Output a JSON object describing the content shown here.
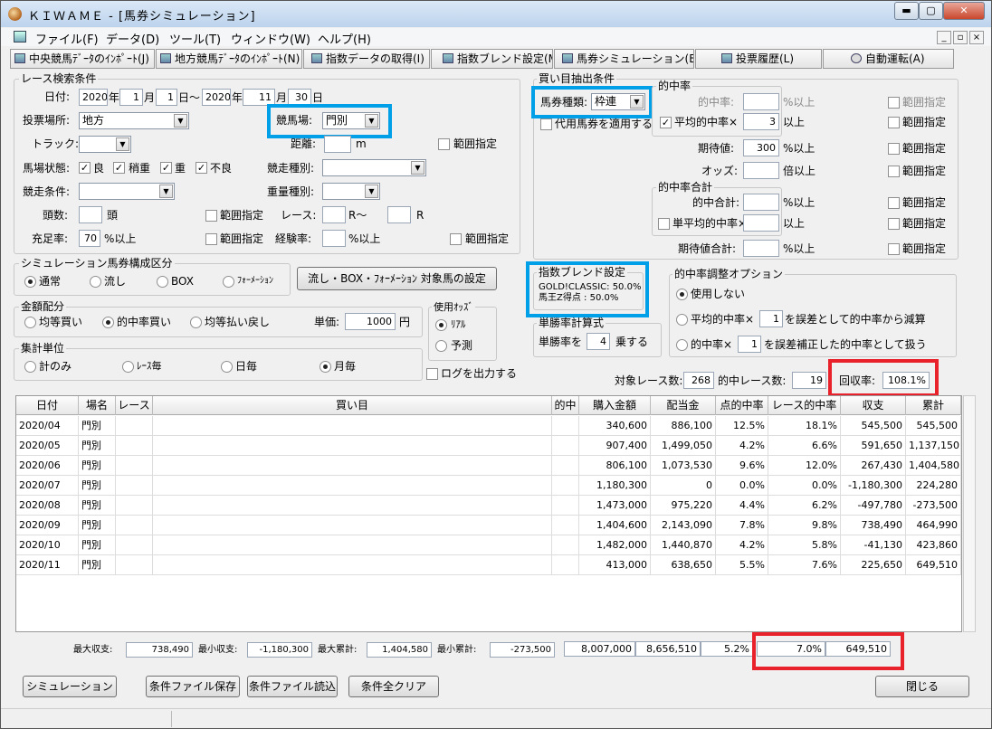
{
  "window": {
    "title": "ＫＩＷＡＭＥ - [馬券シミュレーション]",
    "minimize": "▬",
    "maximize": "▢",
    "close": "✕"
  },
  "menu": [
    "ファイル(F)",
    "データ(D)",
    "ツール(T)",
    "ウィンドウ(W)",
    "ヘルプ(H)"
  ],
  "mdi": [
    "_",
    "▫",
    "×"
  ],
  "toolbar": [
    "中央競馬ﾃﾞｰﾀのｲﾝﾎﾟｰﾄ(J)",
    "地方競馬ﾃﾞｰﾀのｲﾝﾎﾟｰﾄ(N)",
    "指数データの取得(I)",
    "指数ブレンド設定(M)",
    "馬券シミュレーション(B)",
    "投票履歴(L)",
    "自動運転(A)"
  ],
  "race": {
    "title": "レース検索条件",
    "date_label": "日付:",
    "y1": "2020",
    "m1": "1",
    "d1": "1",
    "y2": "2020",
    "m2": "11",
    "d2": "30",
    "nen": "年",
    "tsuki": "月",
    "hi": "日",
    "kara": "日～",
    "venue_label": "投票場所:",
    "venue": "地方",
    "keiba_label": "競馬場:",
    "keiba": "門別",
    "track_label": "トラック:",
    "distance_label": "距離:",
    "distance_unit": "m",
    "range": "範囲指定",
    "baba_label": "馬場状態:",
    "baba": [
      "良",
      "稍重",
      "重",
      "不良"
    ],
    "kyoso_label": "競走種別:",
    "joken_label": "競走条件:",
    "juryo_label": "重量種別:",
    "tosu_label": "頭数:",
    "tosu_unit": "頭",
    "race_label": "レース:",
    "race_from": "R～",
    "race_to": "R",
    "juso_label": "充足率:",
    "juso_val": "70",
    "ijo": "%以上",
    "keiken_label": "経験率:",
    "keiken_unit": "%以上"
  },
  "sim": {
    "title": "シミュレーション馬券構成区分",
    "opts": [
      "通常",
      "流し",
      "BOX",
      "ﾌｫｰﾒｰｼｮﾝ"
    ],
    "setting_btn": "流し・BOX・ﾌｫｰﾒｰｼｮﾝ 対象馬の設定"
  },
  "kingaku": {
    "title": "金額配分",
    "opts": [
      "均等買い",
      "的中率買い",
      "均等払い戻し"
    ],
    "tanka_label": "単価:",
    "tanka": "1000",
    "yen": "円"
  },
  "odds": {
    "title": "使用ｵｯｽﾞ",
    "opts": [
      "ﾘｱﾙ",
      "予測"
    ]
  },
  "shukei": {
    "title": "集計単位",
    "opts": [
      "計のみ",
      "ﾚｰｽ毎",
      "日毎",
      "月毎"
    ]
  },
  "log": "ログを出力する",
  "kaime": {
    "title": "買い目抽出条件",
    "shurui_label": "馬券種類:",
    "shurui": "枠連",
    "daiyo": "代用馬券を適用する"
  },
  "tekichu": {
    "title": "的中率",
    "rate_label": "的中率:",
    "avg_label": "平均的中率×",
    "avg_val": "3",
    "ijo": "%以上",
    "ijo2": "以上",
    "kitai_label": "期待値:",
    "kitai_val": "300",
    "odds_label": "オッズ:",
    "odds_unit": "倍以上",
    "range": "範囲指定"
  },
  "gokei": {
    "title": "的中率合計",
    "total_label": "的中合計:",
    "tan_label": "単平均的中率×",
    "kitai_label": "期待値合計:",
    "pct": "%以上",
    "ijo": "以上"
  },
  "blend": {
    "title": "指数ブレンド設定",
    "l1": "GOLD!CLASSIC: 50.0%",
    "l2": "馬王Z得点 : 50.0%"
  },
  "chosei": {
    "title": "的中率調整オプション",
    "o1": "使用しない",
    "o2a": "平均的中率×",
    "o2v": "1",
    "o2b": "を誤差として的中率から減算",
    "o3a": "的中率×",
    "o3v": "1",
    "o3b": "を誤差補正した的中率として扱う"
  },
  "tansho": {
    "title": "単勝率計算式",
    "a": "単勝率を",
    "v": "4",
    "b": "乗する"
  },
  "summary": {
    "target_label": "対象レース数:",
    "target": "268",
    "hit_label": "的中レース数:",
    "hit": "19",
    "recov_label": "回収率:",
    "recov": "108.1%"
  },
  "table": {
    "headers": [
      "日付",
      "場名",
      "レース",
      "買い目",
      "的中",
      "購入金額",
      "配当金",
      "点的中率",
      "レース的中率",
      "収支",
      "累計"
    ],
    "rows": [
      [
        "2020/04",
        "門別",
        "",
        "",
        "",
        "340,600",
        "886,100",
        "12.5%",
        "18.1%",
        "545,500",
        "545,500"
      ],
      [
        "2020/05",
        "門別",
        "",
        "",
        "",
        "907,400",
        "1,499,050",
        "4.2%",
        "6.6%",
        "591,650",
        "1,137,150"
      ],
      [
        "2020/06",
        "門別",
        "",
        "",
        "",
        "806,100",
        "1,073,530",
        "9.6%",
        "12.0%",
        "267,430",
        "1,404,580"
      ],
      [
        "2020/07",
        "門別",
        "",
        "",
        "",
        "1,180,300",
        "0",
        "0.0%",
        "0.0%",
        "-1,180,300",
        "224,280"
      ],
      [
        "2020/08",
        "門別",
        "",
        "",
        "",
        "1,473,000",
        "975,220",
        "4.4%",
        "6.2%",
        "-497,780",
        "-273,500"
      ],
      [
        "2020/09",
        "門別",
        "",
        "",
        "",
        "1,404,600",
        "2,143,090",
        "7.8%",
        "9.8%",
        "738,490",
        "464,990"
      ],
      [
        "2020/10",
        "門別",
        "",
        "",
        "",
        "1,482,000",
        "1,440,870",
        "4.2%",
        "5.8%",
        "-41,130",
        "423,860"
      ],
      [
        "2020/11",
        "門別",
        "",
        "",
        "",
        "413,000",
        "638,650",
        "5.5%",
        "7.6%",
        "225,650",
        "649,510"
      ]
    ]
  },
  "footer": {
    "max_label": "最大収支:",
    "max": "738,490",
    "min_label": "最小収支:",
    "min": "-1,180,300",
    "maxc_label": "最大累計:",
    "maxc": "1,404,580",
    "minc_label": "最小累計:",
    "minc": "-273,500",
    "buy": "8,007,000",
    "pay": "8,656,510",
    "pt": "5.2%",
    "race": "7.0%",
    "total": "649,510"
  },
  "buttons": {
    "sim": "シミュレーション",
    "save": "条件ファイル保存",
    "load": "条件ファイル読込",
    "clear": "条件全クリア",
    "close": "閉じる"
  },
  "colors": {
    "highlight_blue": "#00a0e9",
    "highlight_red": "#e8212b"
  }
}
